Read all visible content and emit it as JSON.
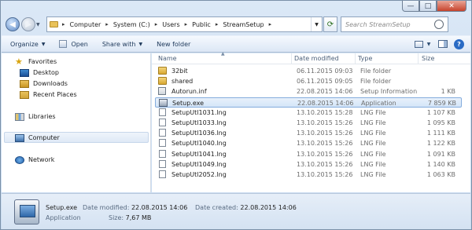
{
  "window": {
    "caption_minimize": "—",
    "caption_maximize": "□",
    "caption_close": "✕"
  },
  "address": {
    "crumbs": [
      "Computer",
      "System (C:)",
      "Users",
      "Public",
      "StreamSetup"
    ],
    "separator": "▸"
  },
  "search": {
    "placeholder": "Search StreamSetup"
  },
  "toolbar": {
    "organize": "Organize",
    "open": "Open",
    "share_with": "Share with",
    "new_folder": "New folder"
  },
  "navpane": {
    "favorites": "Favorites",
    "desktop": "Desktop",
    "downloads": "Downloads",
    "recent_places": "Recent Places",
    "libraries": "Libraries",
    "computer": "Computer",
    "network": "Network"
  },
  "columns": {
    "name": "Name",
    "date": "Date modified",
    "type": "Type",
    "size": "Size"
  },
  "files": [
    {
      "name": "32bit",
      "date": "06.11.2015 09:03",
      "type": "File folder",
      "size": "",
      "icon": "folder"
    },
    {
      "name": "shared",
      "date": "06.11.2015 09:05",
      "type": "File folder",
      "size": "",
      "icon": "folder"
    },
    {
      "name": "Autorun.inf",
      "date": "22.08.2015 14:06",
      "type": "Setup Information",
      "size": "1 KB",
      "icon": "inf"
    },
    {
      "name": "Setup.exe",
      "date": "22.08.2015 14:06",
      "type": "Application",
      "size": "7 859 KB",
      "icon": "exe",
      "selected": true
    },
    {
      "name": "SetupUtl1031.lng",
      "date": "13.10.2015 15:28",
      "type": "LNG File",
      "size": "1 107 KB",
      "icon": "doc"
    },
    {
      "name": "SetupUtl1033.lng",
      "date": "13.10.2015 15:26",
      "type": "LNG File",
      "size": "1 095 KB",
      "icon": "doc"
    },
    {
      "name": "SetupUtl1036.lng",
      "date": "13.10.2015 15:26",
      "type": "LNG File",
      "size": "1 111 KB",
      "icon": "doc"
    },
    {
      "name": "SetupUtl1040.lng",
      "date": "13.10.2015 15:26",
      "type": "LNG File",
      "size": "1 122 KB",
      "icon": "doc"
    },
    {
      "name": "SetupUtl1041.lng",
      "date": "13.10.2015 15:26",
      "type": "LNG File",
      "size": "1 091 KB",
      "icon": "doc"
    },
    {
      "name": "SetupUtl1049.lng",
      "date": "13.10.2015 15:26",
      "type": "LNG File",
      "size": "1 140 KB",
      "icon": "doc"
    },
    {
      "name": "SetupUtl2052.lng",
      "date": "13.10.2015 15:26",
      "type": "LNG File",
      "size": "1 063 KB",
      "icon": "doc"
    }
  ],
  "details": {
    "filename": "Setup.exe",
    "kind": "Application",
    "modified_label": "Date modified:",
    "modified_value": "22.08.2015 14:06",
    "size_label": "Size:",
    "size_value": "7,67 MB",
    "created_label": "Date created:",
    "created_value": "22.08.2015 14:06"
  }
}
